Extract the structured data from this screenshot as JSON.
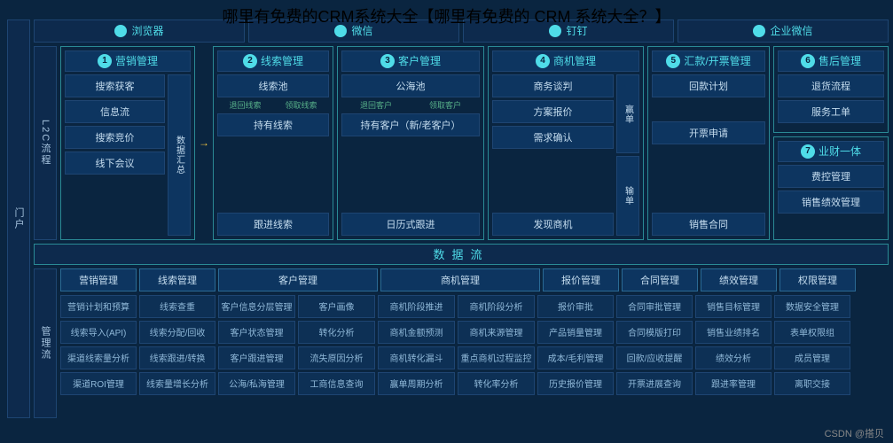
{
  "title_overlay": "哪里有免费的CRM系统大全【哪里有免费的 CRM 系统大全？】",
  "watermark": "CSDN @搭贝",
  "sidebar": {
    "portal": "门户",
    "l2c": "L2C流程",
    "mgt": "管理流"
  },
  "portals": [
    "浏览器",
    "微信",
    "钉钉",
    "企业微信"
  ],
  "sections": {
    "s1": {
      "num": "1",
      "title": "营销管理",
      "items": [
        "搜索获客",
        "信息流",
        "搜索竞价",
        "线下会议"
      ],
      "side": "数据汇总"
    },
    "s2": {
      "num": "2",
      "title": "线索管理",
      "items": [
        "线索池",
        "持有线索",
        "跟进线索"
      ],
      "flow": [
        "退回线索",
        "领取线索"
      ]
    },
    "s3": {
      "num": "3",
      "title": "客户管理",
      "items": [
        "公海池",
        "持有客户（新/老客户）",
        "日历式跟进"
      ],
      "flow": [
        "退回客户",
        "领取客户"
      ]
    },
    "s4": {
      "num": "4",
      "title": "商机管理",
      "items": [
        "商务谈判",
        "方案报价",
        "需求确认",
        "发现商机"
      ],
      "side1": "赢单",
      "side2": "输单"
    },
    "s5": {
      "num": "5",
      "title": "汇款/开票管理",
      "items": [
        "回款计划",
        "开票申请",
        "销售合同"
      ]
    },
    "s6": {
      "num": "6",
      "title": "售后管理",
      "items": [
        "退货流程",
        "服务工单"
      ]
    },
    "s7": {
      "num": "7",
      "title": "业财一体",
      "items": [
        "费控管理",
        "销售绩效管理"
      ]
    }
  },
  "databar": "数据流",
  "mgt_headers": [
    "营销管理",
    "线索管理",
    "客户管理",
    "商机管理",
    "报价管理",
    "合同管理",
    "绩效管理",
    "权限管理"
  ],
  "mgt_cols": {
    "c1": [
      "营销计划和预算",
      "线索导入(API)",
      "渠道线索量分析",
      "渠道ROI管理"
    ],
    "c2": [
      "线索查重",
      "线索分配/回收",
      "线索跟进/转换",
      "线索量增长分析"
    ],
    "c3a": [
      "客户信息分层管理",
      "客户状态管理",
      "客户跟进管理",
      "公海/私海管理"
    ],
    "c3b": [
      "客户画像",
      "转化分析",
      "流失原因分析",
      "工商信息查询"
    ],
    "c4a": [
      "商机阶段推进",
      "商机金额预测",
      "商机转化漏斗",
      "赢单周期分析"
    ],
    "c4b": [
      "商机阶段分析",
      "商机来源管理",
      "重点商机过程监控",
      "转化率分析"
    ],
    "c5": [
      "报价审批",
      "产品销量管理",
      "成本/毛利管理",
      "历史报价管理"
    ],
    "c6": [
      "合同审批管理",
      "合同模版打印",
      "回款/应收提醒",
      "开票进展查询"
    ],
    "c7": [
      "销售目标管理",
      "销售业绩排名",
      "绩效分析",
      "跟进率管理"
    ],
    "c8": [
      "数据安全管理",
      "表单权限组",
      "成员管理",
      "离职交接"
    ]
  }
}
